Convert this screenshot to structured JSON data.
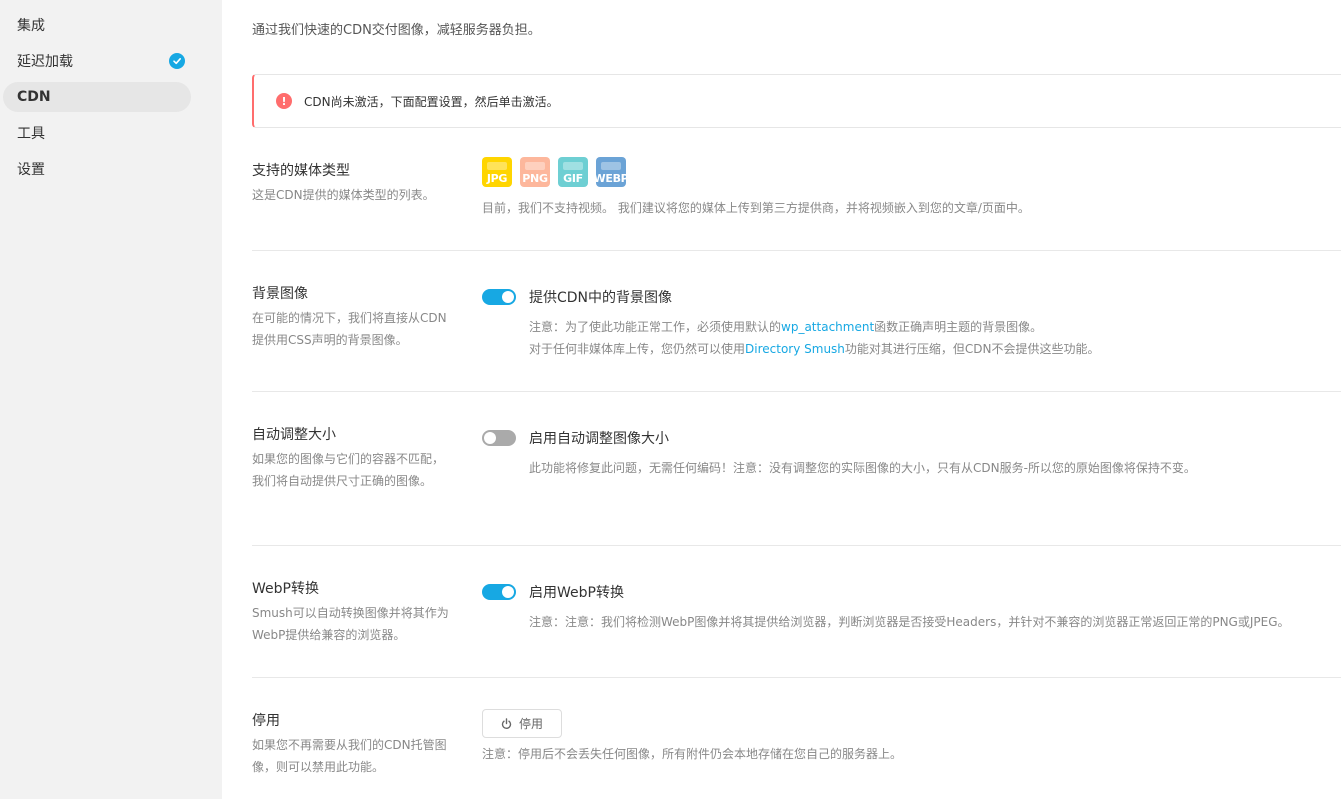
{
  "sidebar": {
    "items": [
      {
        "label": "集成"
      },
      {
        "label": "延迟加载"
      },
      {
        "label": "CDN"
      },
      {
        "label": "工具"
      },
      {
        "label": "设置"
      }
    ]
  },
  "intro": "通过我们快速的CDN交付图像，减轻服务器负担。",
  "notice": "CDN尚未激活，下面配置设置，然后单击激活。",
  "media_types": {
    "title": "支持的媒体类型",
    "desc": "这是CDN提供的媒体类型的列表。",
    "badges": [
      "JPG",
      "PNG",
      "GIF",
      "WEBP"
    ],
    "note": "目前，我们不支持视频。 我们建议将您的媒体上传到第三方提供商，并将视频嵌入到您的文章/页面中。"
  },
  "background": {
    "title": "背景图像",
    "desc": "在可能的情况下，我们将直接从CDN提供用CSS声明的背景图像。",
    "toggle_label": "提供CDN中的背景图像",
    "enabled": true,
    "note1_a": "注意：为了使此功能正常工作，必须使用默认的",
    "note1_link": "wp_attachment",
    "note1_b": "函数正确声明主题的背景图像。",
    "note2_a": "对于任何非媒体库上传，您仍然可以使用",
    "note2_link": "Directory Smush",
    "note2_b": "功能对其进行压缩，但CDN不会提供这些功能。"
  },
  "resize": {
    "title": "自动调整大小",
    "desc": "如果您的图像与它们的容器不匹配，我们将自动提供尺寸正确的图像。",
    "toggle_label": "启用自动调整图像大小",
    "enabled": false,
    "note": "此功能将修复此问题，无需任何编码！注意：没有调整您的实际图像的大小，只有从CDN服务-所以您的原始图像将保持不变。"
  },
  "webp": {
    "title": "WebP转换",
    "desc": "Smush可以自动转换图像并将其作为WebP提供给兼容的浏览器。",
    "toggle_label": "启用WebP转换",
    "enabled": true,
    "note": "注意：注意：我们将检测WebP图像并将其提供给浏览器，判断浏览器是否接受Headers，并针对不兼容的浏览器正常返回正常的PNG或JPEG。"
  },
  "deactivate": {
    "title": "停用",
    "desc": "如果您不再需要从我们的CDN托管图像，则可以禁用此功能。",
    "button_label": "停用",
    "note": "注意：停用后不会丢失任何图像，所有附件仍会本地存储在您自己的服务器上。"
  },
  "colors": {
    "accent": "#17a8e3",
    "error": "#ff6d6d",
    "jpg": "#ffd500",
    "png": "#fdb79c",
    "gif": "#6ecfd3",
    "webp": "#6ba3d6"
  }
}
